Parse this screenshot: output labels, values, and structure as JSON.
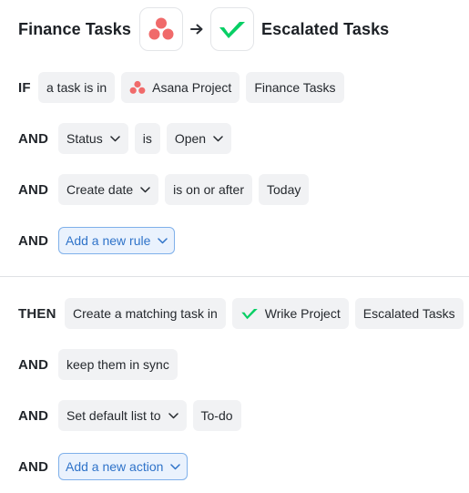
{
  "header": {
    "source_title": "Finance Tasks",
    "dest_title": "Escalated Tasks",
    "source_app_icon": "asana-logo-icon",
    "dest_app_icon": "wrike-logo-icon",
    "arrow_icon": "arrow-right-icon"
  },
  "rules": {
    "if_keyword": "IF",
    "and_keyword": "AND",
    "task_in_label": "a task is in",
    "project_app_label": "Asana Project",
    "project_value": "Finance Tasks",
    "status_field": "Status",
    "status_op": "is",
    "status_value": "Open",
    "date_field": "Create date",
    "date_op": "is on or after",
    "date_value": "Today",
    "add_rule_label": "Add a new rule"
  },
  "actions": {
    "then_keyword": "THEN",
    "and_keyword": "AND",
    "create_label": "Create a matching task in",
    "project_app_label": "Wrike Project",
    "project_value": "Escalated Tasks",
    "sync_label": "keep them in sync",
    "default_list_label": "Set default list to",
    "default_list_value": "To-do",
    "add_action_label": "Add a new action"
  },
  "colors": {
    "asana": "#f06a6a",
    "wrike": "#08cf65",
    "add_button_bg": "#eaf2fd",
    "add_button_border": "#7fb0ea",
    "add_button_text": "#2f73c9",
    "pill_bg": "#f1f2f4"
  }
}
